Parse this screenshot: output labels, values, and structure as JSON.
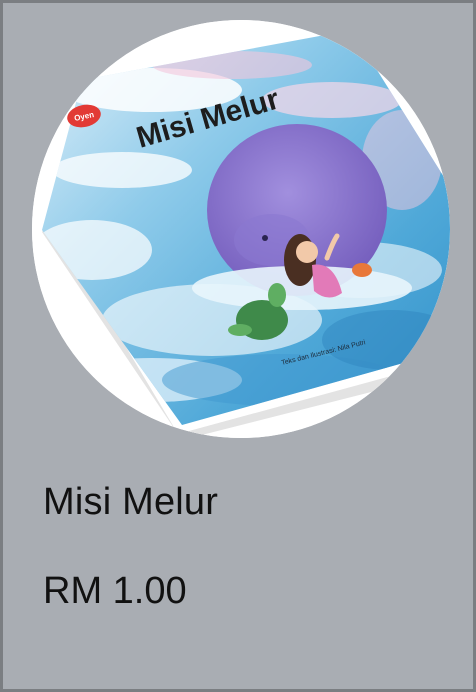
{
  "product": {
    "title": "Misi Melur",
    "price": "RM 1.00"
  },
  "cover": {
    "title_text": "Misi Melur",
    "publisher_badge": "Oyen",
    "credit_line": "Teks dan Ilustrasi: Nila Putri"
  },
  "colors": {
    "card_background": "#a9adb3",
    "card_border": "#7b7e82",
    "text": "#111111"
  }
}
